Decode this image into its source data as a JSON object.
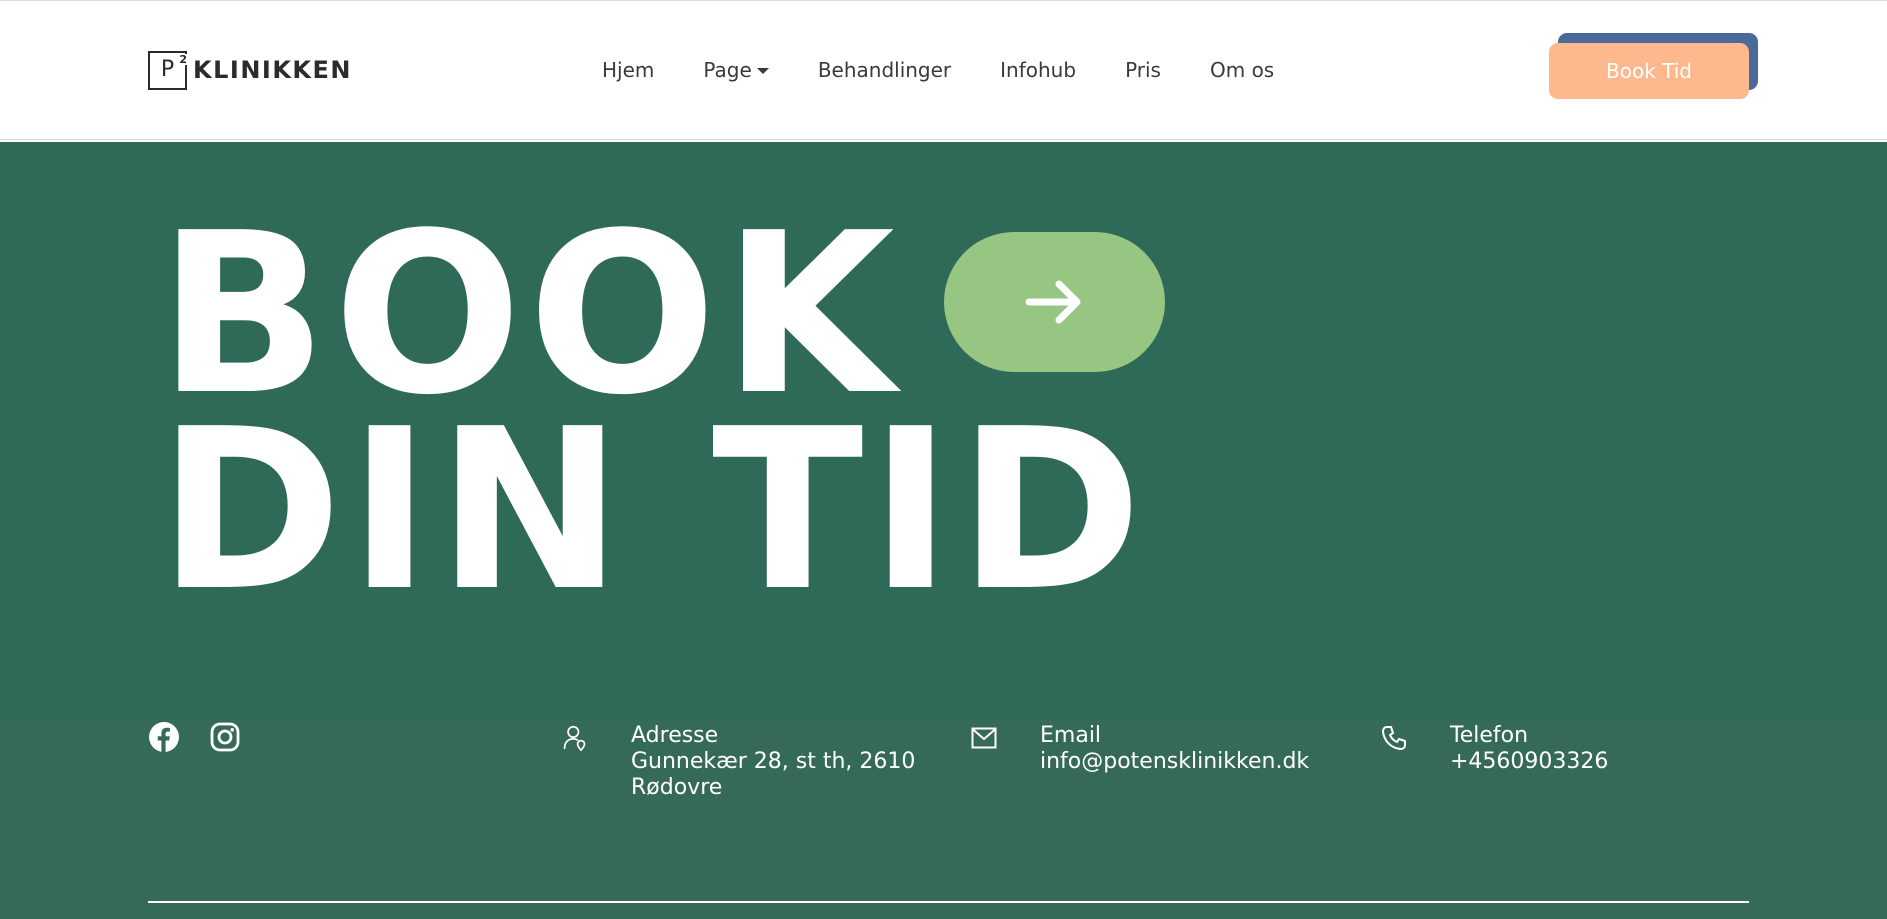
{
  "header": {
    "logo": {
      "mark_letter": "P",
      "mark_superscript": "2",
      "text": "KLINIKKEN"
    },
    "nav": [
      {
        "label": "Hjem",
        "has_dropdown": false
      },
      {
        "label": "Page",
        "has_dropdown": true
      },
      {
        "label": "Behandlinger",
        "has_dropdown": false
      },
      {
        "label": "Infohub",
        "has_dropdown": false
      },
      {
        "label": "Pris",
        "has_dropdown": false
      },
      {
        "label": "Om os",
        "has_dropdown": false
      }
    ],
    "cta_label": "Book Tid"
  },
  "hero": {
    "line1": "BOOK",
    "line2": "DIN TID",
    "arrow_icon": "arrow-right-icon"
  },
  "contact": {
    "social_icons": [
      "facebook-icon",
      "instagram-icon"
    ],
    "address": {
      "icon": "location-pin-icon",
      "label": "Adresse",
      "value": "Gunnekær 28, st th, 2610\nRødovre"
    },
    "email": {
      "icon": "envelope-icon",
      "label": "Email",
      "value": "info@potensklinikken.dk"
    },
    "phone": {
      "icon": "phone-icon",
      "label": "Telefon",
      "value": "+4560903326"
    }
  },
  "colors": {
    "hero_bg": "#2f6a58",
    "footer_bg": "#366a58",
    "cta_bg": "#fdb88e",
    "cta_shadow": "#4a6a9a",
    "arrow_button_bg": "#97c682"
  }
}
